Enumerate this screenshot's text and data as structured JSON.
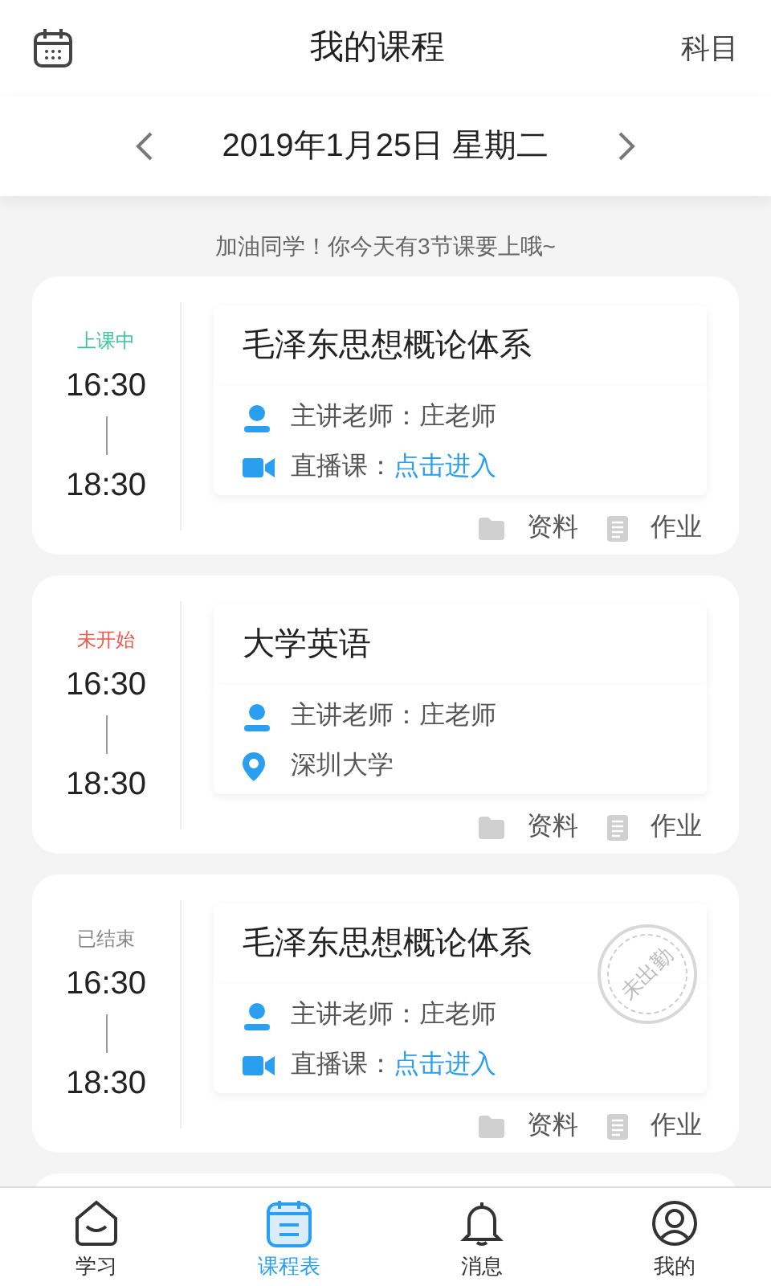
{
  "header": {
    "title": "我的课程",
    "right_action": "科目"
  },
  "date_bar": {
    "date": "2019年1月25日 星期二"
  },
  "greeting": "加油同学！你今天有3节课要上哦~",
  "courses": [
    {
      "status": {
        "kind": "in_class",
        "text": "上课中"
      },
      "start": "16:30",
      "end": "18:30",
      "title": "毛泽东思想概论体系",
      "rows": [
        {
          "kind": "teacher",
          "label": "主讲老师：庄老师"
        },
        {
          "kind": "live",
          "label": "直播课：",
          "link": "点击进入"
        }
      ],
      "actions": [
        "资料",
        "作业"
      ]
    },
    {
      "status": {
        "kind": "not_started",
        "text": "未开始"
      },
      "start": "16:30",
      "end": "18:30",
      "title": "大学英语",
      "rows": [
        {
          "kind": "teacher",
          "label": "主讲老师：庄老师"
        },
        {
          "kind": "location",
          "label": "深圳大学"
        }
      ],
      "actions": [
        "资料",
        "作业"
      ]
    },
    {
      "status": {
        "kind": "ended",
        "text": "已结束"
      },
      "start": "16:30",
      "end": "18:30",
      "title": "毛泽东思想概论体系",
      "rows": [
        {
          "kind": "teacher",
          "label": "主讲老师：庄老师"
        },
        {
          "kind": "live",
          "label": "直播课：",
          "link": "点击进入"
        }
      ],
      "actions": [
        "资料",
        "作业"
      ],
      "stamp": "未出勤"
    }
  ],
  "tab_bar": [
    {
      "kind": "study",
      "label": "学习",
      "selected": false
    },
    {
      "kind": "schedule",
      "label": "课程表",
      "selected": true
    },
    {
      "kind": "messages",
      "label": "消息",
      "selected": false
    },
    {
      "kind": "profile",
      "label": "我的",
      "selected": false
    }
  ]
}
